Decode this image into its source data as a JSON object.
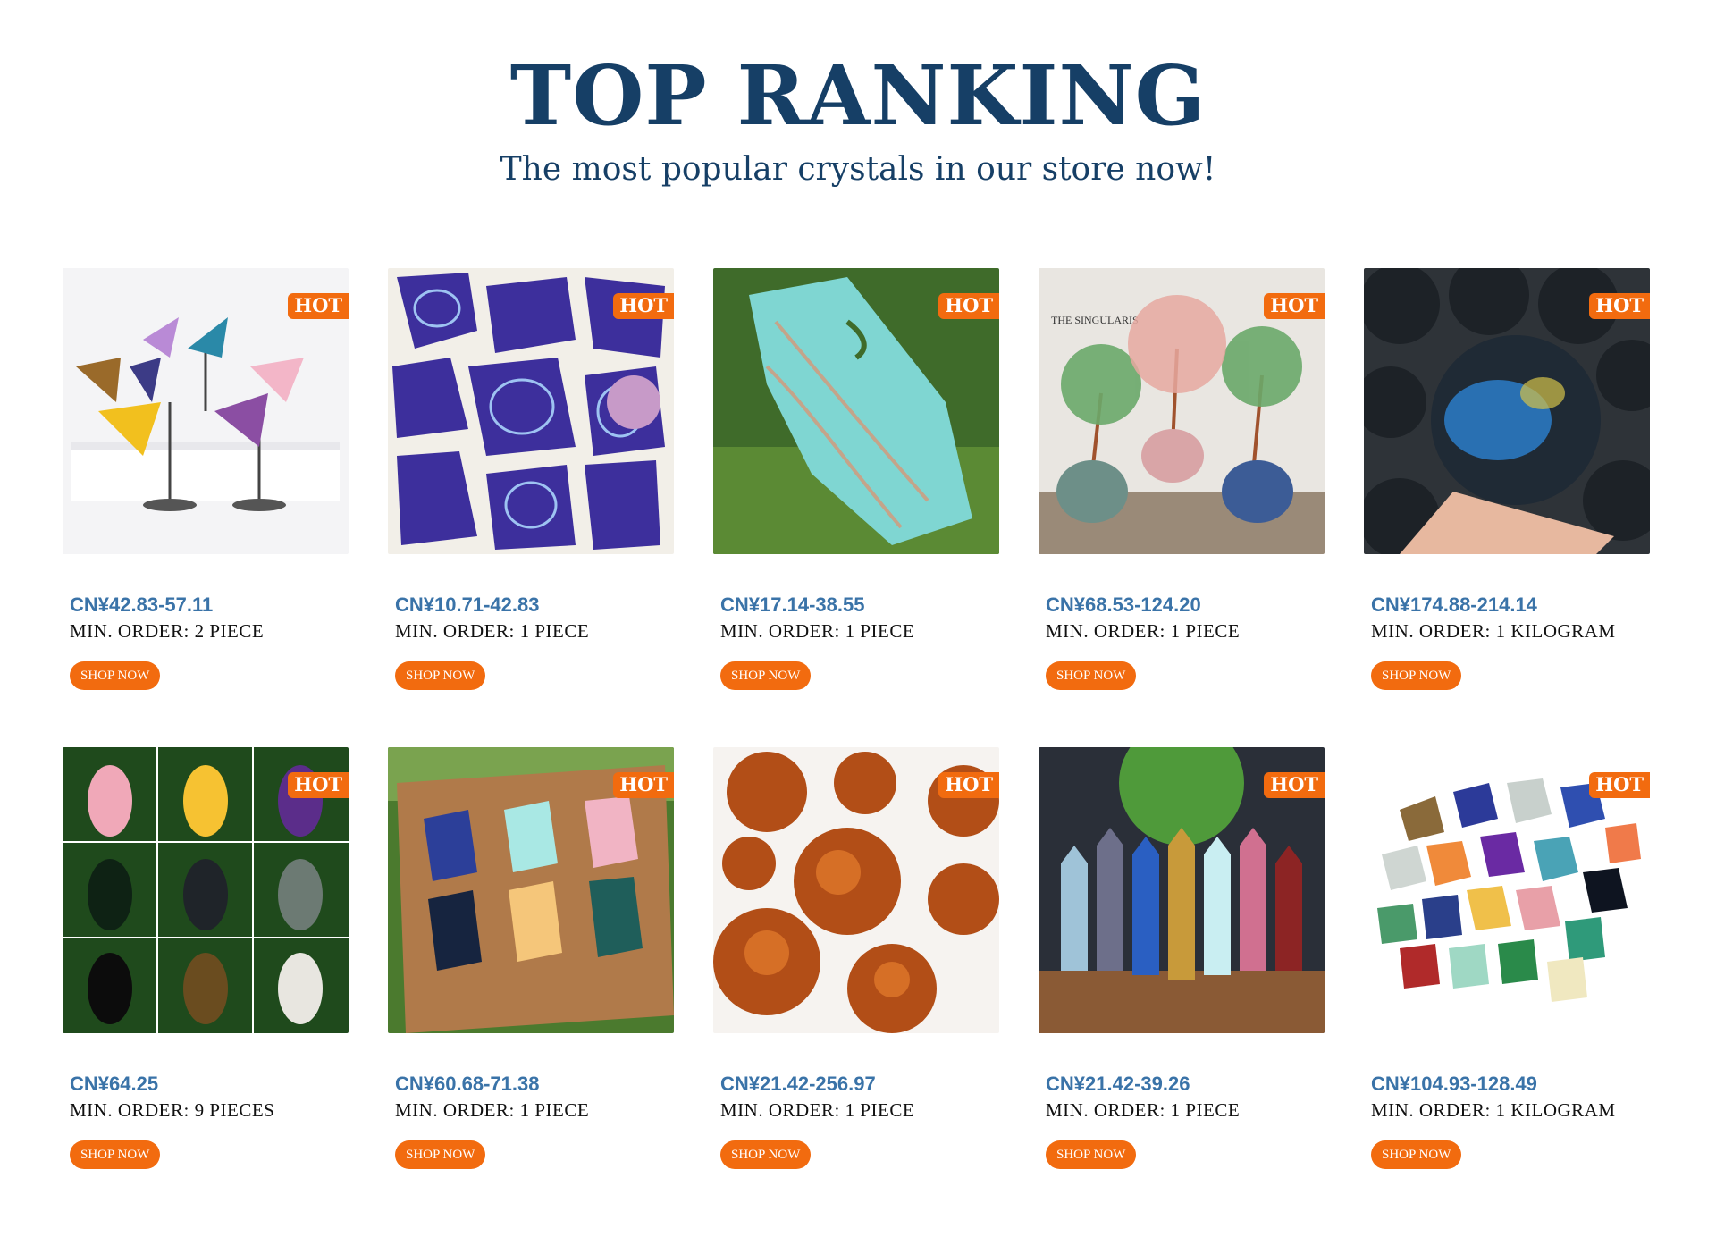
{
  "header": {
    "title": "TOP RANKING",
    "subtitle": "The most popular crystals in our store now!"
  },
  "colors": {
    "title": "#163f66",
    "price": "#3a73a8",
    "accent": "#f26b0f"
  },
  "products": [
    {
      "badge": "HOT",
      "price": "CN¥42.83-57.11",
      "moq": "MIN. ORDER: 2 PIECE",
      "button": "SHOP NOW",
      "image": "butterfly-wing-crystal-carvings"
    },
    {
      "badge": "HOT",
      "price": "CN¥10.71-42.83",
      "moq": "MIN. ORDER: 1 PIECE",
      "button": "SHOP NOW",
      "image": "blue-agate-slices"
    },
    {
      "badge": "HOT",
      "price": "CN¥17.14-38.55",
      "moq": "MIN. ORDER: 1 PIECE",
      "button": "SHOP NOW",
      "image": "blue-aragonite-slab"
    },
    {
      "badge": "HOT",
      "price": "CN¥68.53-124.20",
      "moq": "MIN. ORDER: 1 PIECE",
      "button": "SHOP NOW",
      "image": "crystal-gem-trees",
      "image_text": "THE SINGULARIS"
    },
    {
      "badge": "HOT",
      "price": "CN¥174.88-214.14",
      "moq": "MIN. ORDER: 1 KILOGRAM",
      "button": "SHOP NOW",
      "image": "labradorite-spheres"
    },
    {
      "badge": "HOT",
      "price": "CN¥64.25",
      "moq": "MIN. ORDER: 9 PIECES",
      "button": "SHOP NOW",
      "image": "crystal-figurine-carvings"
    },
    {
      "badge": "HOT",
      "price": "CN¥60.68-71.38",
      "moq": "MIN. ORDER: 1 PIECE",
      "button": "SHOP NOW",
      "image": "unicorn-head-carvings"
    },
    {
      "badge": "HOT",
      "price": "CN¥21.42-256.97",
      "moq": "MIN. ORDER: 1 PIECE",
      "button": "SHOP NOW",
      "image": "aragonite-clusters"
    },
    {
      "badge": "HOT",
      "price": "CN¥21.42-39.26",
      "moq": "MIN. ORDER: 1 PIECE",
      "button": "SHOP NOW",
      "image": "crystal-towers"
    },
    {
      "badge": "HOT",
      "price": "CN¥104.93-128.49",
      "moq": "MIN. ORDER: 1 KILOGRAM",
      "button": "SHOP NOW",
      "image": "rough-crystal-mix"
    }
  ]
}
